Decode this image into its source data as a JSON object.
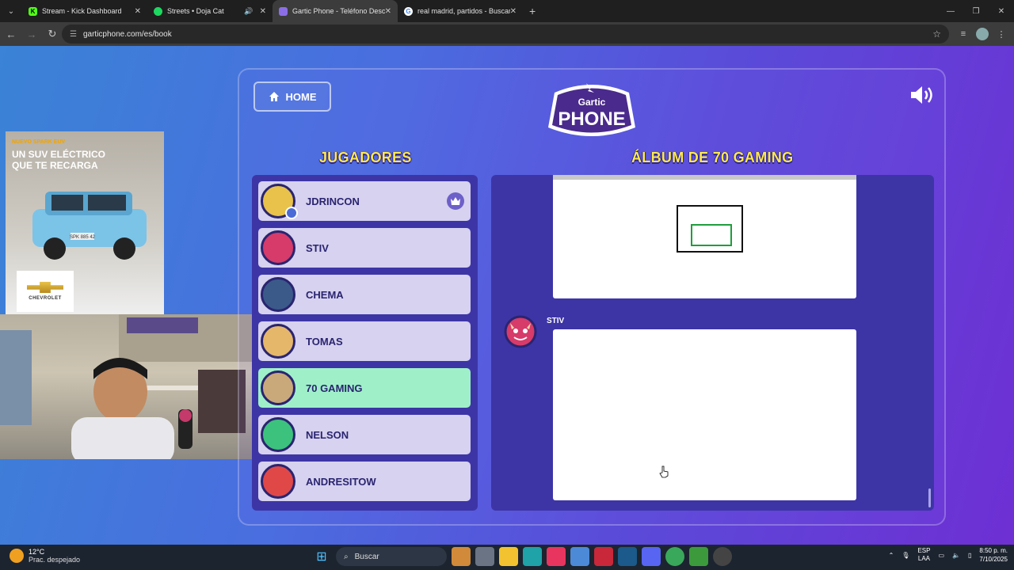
{
  "browser": {
    "tabs": [
      {
        "title": "Stream - Kick Dashboard",
        "favicon": "kick-icon",
        "color": "#53fc18",
        "active": false
      },
      {
        "title": "Streets • Doja Cat",
        "favicon": "spotify-icon",
        "color": "#1ed760",
        "active": false,
        "audio": "🔊"
      },
      {
        "title": "Gartic Phone - Teléfono Descon",
        "favicon": "gartic-icon",
        "color": "#8b6ee6",
        "active": true
      },
      {
        "title": "real madrid, partidos - Buscar c",
        "favicon": "google-icon",
        "color": "#ffffff",
        "active": false
      }
    ],
    "url": "garticphone.com/es/book"
  },
  "game": {
    "home_label": "HOME",
    "logo_top": "Gartic",
    "logo_bottom": "PHONE",
    "players_heading": "JUGADORES",
    "album_heading": "ÁLBUM DE 70 GAMING",
    "players": [
      {
        "name": "JDRINCON",
        "owner": true,
        "active": false,
        "color": "#e8c24a"
      },
      {
        "name": "STIV",
        "owner": false,
        "active": false,
        "color": "#d63b6a"
      },
      {
        "name": "CHEMA",
        "owner": false,
        "active": false,
        "color": "#3b5a8a"
      },
      {
        "name": "TOMAS",
        "owner": false,
        "active": false,
        "color": "#e5b76a"
      },
      {
        "name": "70 GAMING",
        "owner": false,
        "active": true,
        "color": "#c9a97a"
      },
      {
        "name": "NELSON",
        "owner": false,
        "active": false,
        "color": "#3cc27c"
      },
      {
        "name": "ANDRESITOW",
        "owner": false,
        "active": false,
        "color": "#e04848"
      }
    ],
    "album_author": "STIV"
  },
  "ad": {
    "tag": "NUEVO",
    "model": "SPARK EUV",
    "headline": "UN SUV ELÉCTRICO QUE TE RECARGA",
    "brand": "CHEVROLET",
    "plate": "SPK 885 42"
  },
  "taskbar": {
    "temperature": "12°C",
    "weather": "Prac. despejado",
    "search_placeholder": "Buscar",
    "lang1": "ESP",
    "lang2": "LAA",
    "time": "8:50 p. m.",
    "date": "7/10/2025"
  }
}
